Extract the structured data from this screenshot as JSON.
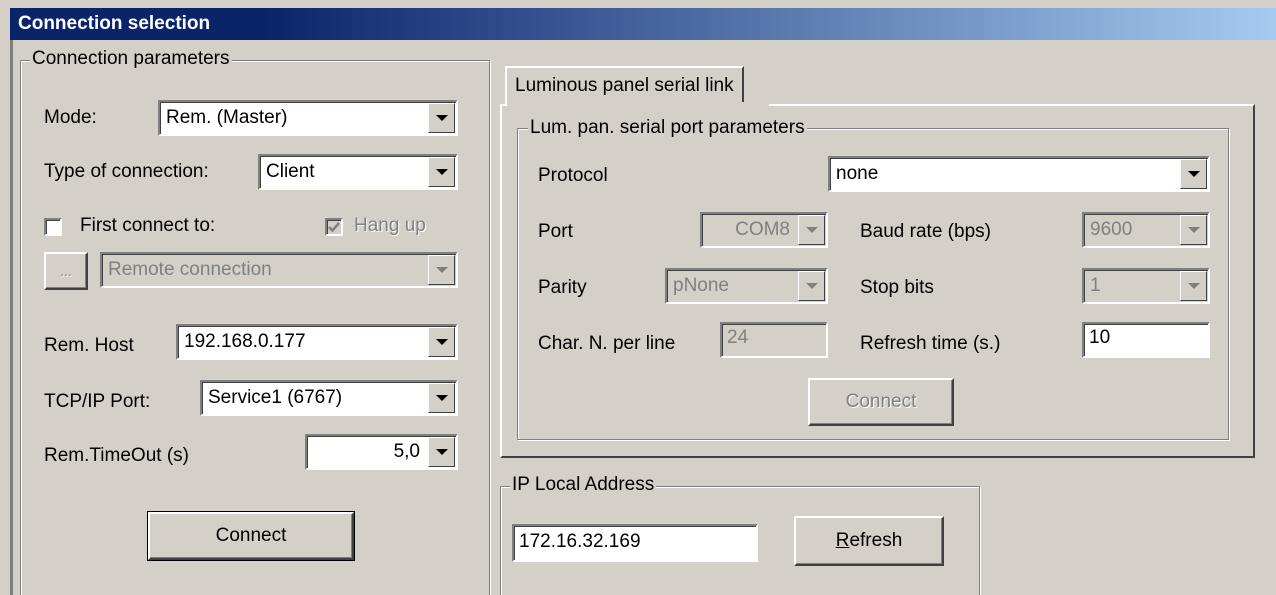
{
  "window": {
    "title": "Connection selection"
  },
  "connection_parameters": {
    "legend": "Connection parameters",
    "mode_label": "Mode:",
    "mode_value": "Rem. (Master)",
    "type_label": "Type of connection:",
    "type_value": "Client",
    "first_connect_label": "First connect to:",
    "first_connect_checked": false,
    "hang_up_label": "Hang up",
    "hang_up_checked": true,
    "browse_label": "...",
    "remote_connection_value": "Remote connection",
    "rem_host_label": "Rem. Host",
    "rem_host_value": "192.168.0.177",
    "tcp_port_label": "TCP/IP Port:",
    "tcp_port_value": "Service1 (6767)",
    "timeout_label": "Rem.TimeOut (s)",
    "timeout_value": "5,0",
    "connect_label": "Connect"
  },
  "luminous_panel": {
    "tab_label": "Luminous panel serial link",
    "legend": "Lum. pan. serial port parameters",
    "protocol_label": "Protocol",
    "protocol_value": "none",
    "port_label": "Port",
    "port_value": "COM8",
    "baud_label": "Baud rate (bps)",
    "baud_value": "9600",
    "parity_label": "Parity",
    "parity_value": "pNone",
    "stop_bits_label": "Stop bits",
    "stop_bits_value": "1",
    "chars_label": "Char. N. per line",
    "chars_value": "24",
    "refresh_time_label": "Refresh time (s.)",
    "refresh_time_value": "10",
    "connect_label": "Connect"
  },
  "ip_local": {
    "legend": "IP Local Address",
    "address_value": "172.16.32.169",
    "refresh_label": "Refresh"
  }
}
